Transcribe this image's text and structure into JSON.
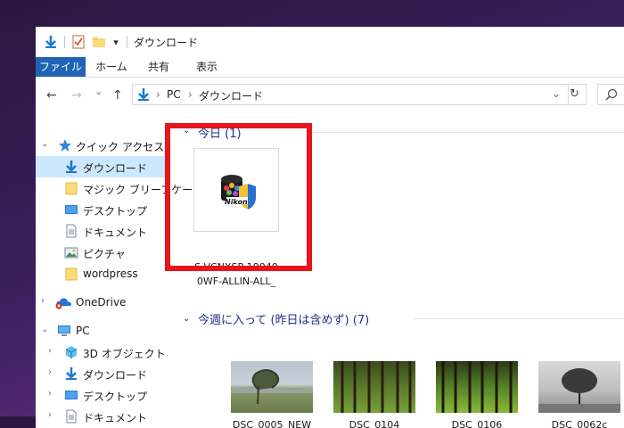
{
  "window": {
    "title": "ダウンロード",
    "dropdown_glyph": "▾"
  },
  "ribbon": {
    "tabs": [
      {
        "label": "ファイル"
      },
      {
        "label": "ホーム"
      },
      {
        "label": "共有"
      },
      {
        "label": "表示"
      }
    ]
  },
  "address_bar": {
    "back_glyph": "←",
    "forward_glyph": "→",
    "recent_glyph": "⌄",
    "up_glyph": "↑",
    "separator": "›",
    "crumbs": [
      "PC",
      "ダウンロード"
    ],
    "dropdown_glyph": "⌄",
    "refresh_glyph": "↻"
  },
  "sidebar": {
    "quick_access": {
      "label": "クイック アクセス"
    },
    "items": [
      {
        "label": "ダウンロード",
        "icon": "download-arrow-icon",
        "selected": true
      },
      {
        "label": "マジック ブリーフケー",
        "icon": "folder-icon"
      },
      {
        "label": "デスクトップ",
        "icon": "desktop-icon"
      },
      {
        "label": "ドキュメント",
        "icon": "document-icon"
      },
      {
        "label": "ピクチャ",
        "icon": "pictures-icon"
      },
      {
        "label": "wordpress",
        "icon": "folder-icon"
      }
    ],
    "onedrive": {
      "label": "OneDrive"
    },
    "pc": {
      "label": "PC"
    },
    "pc_items": [
      {
        "label": "3D オブジェクト",
        "icon": "3d-objects-icon"
      },
      {
        "label": "ダウンロード",
        "icon": "download-arrow-icon"
      },
      {
        "label": "デスクトップ",
        "icon": "desktop-icon"
      },
      {
        "label": "ドキュメント",
        "icon": "document-icon"
      }
    ]
  },
  "groups": {
    "today": {
      "label": "今日 (1)"
    },
    "this_week": {
      "label": "今週に入って (昨日は含めず) (7)"
    }
  },
  "files_today": [
    {
      "name_line1": "S-VCNXSP-19040",
      "name_line2": "0WF-ALLIN-ALL_",
      "logo_text": "Nikon"
    }
  ],
  "files_week": [
    {
      "name": "DSC_0005_NEW"
    },
    {
      "name": "DSC_0104"
    },
    {
      "name": "DSC_0106"
    },
    {
      "name": "DSC_0062c"
    }
  ],
  "colors": {
    "accent": "#1f64b5",
    "selection": "#cce8ff",
    "highlight_box": "#e8161c",
    "group_header": "#1e3287"
  }
}
